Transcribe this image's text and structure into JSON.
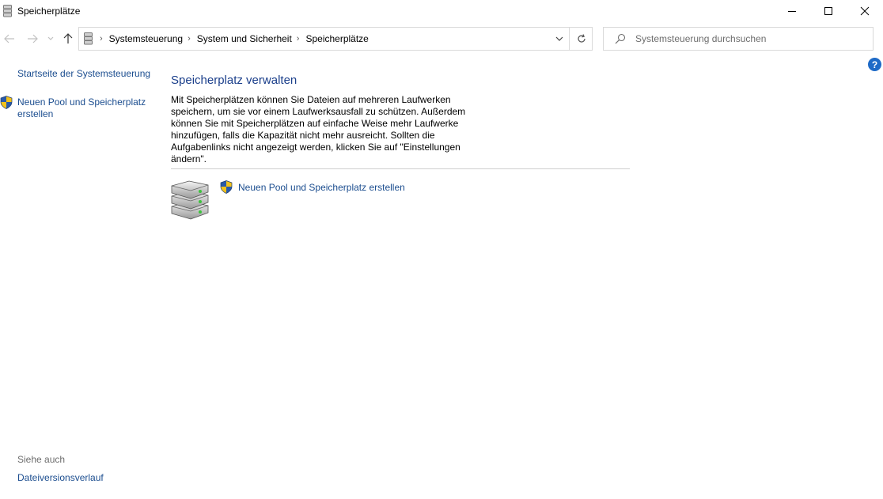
{
  "window": {
    "title": "Speicherplätze",
    "controls": {
      "minimize": "minimize",
      "maximize": "maximize",
      "close": "close"
    }
  },
  "address_bar": {
    "breadcrumbs": [
      "Systemsteuerung",
      "System und Sicherheit",
      "Speicherplätze"
    ]
  },
  "search": {
    "placeholder": "Systemsteuerung durchsuchen"
  },
  "help": {
    "label": "?"
  },
  "left_pane": {
    "home_link": "Startseite der Systemsteuerung",
    "new_pool_link": "Neuen Pool und Speicherplatz erstellen",
    "see_also_heading": "Siehe auch",
    "history_link": "Dateiversionsverlauf"
  },
  "main": {
    "heading": "Speicherplatz verwalten",
    "description": "Mit Speicherplätzen können Sie Dateien auf mehreren Laufwerken speichern, um sie vor einem Laufwerksausfall zu schützen. Außerdem können Sie mit Speicherplätzen auf einfache Weise mehr Laufwerke hinzufügen, falls die Kapazität nicht mehr ausreicht. Sollten die Aufgabenlinks nicht angezeigt werden, klicken Sie auf \"Einstellungen ändern\".",
    "task_link": "Neuen Pool und Speicherplatz erstellen"
  },
  "colors": {
    "link": "#1b4d8f",
    "heading": "#1b3f8b",
    "help": "#1e6ac7"
  }
}
